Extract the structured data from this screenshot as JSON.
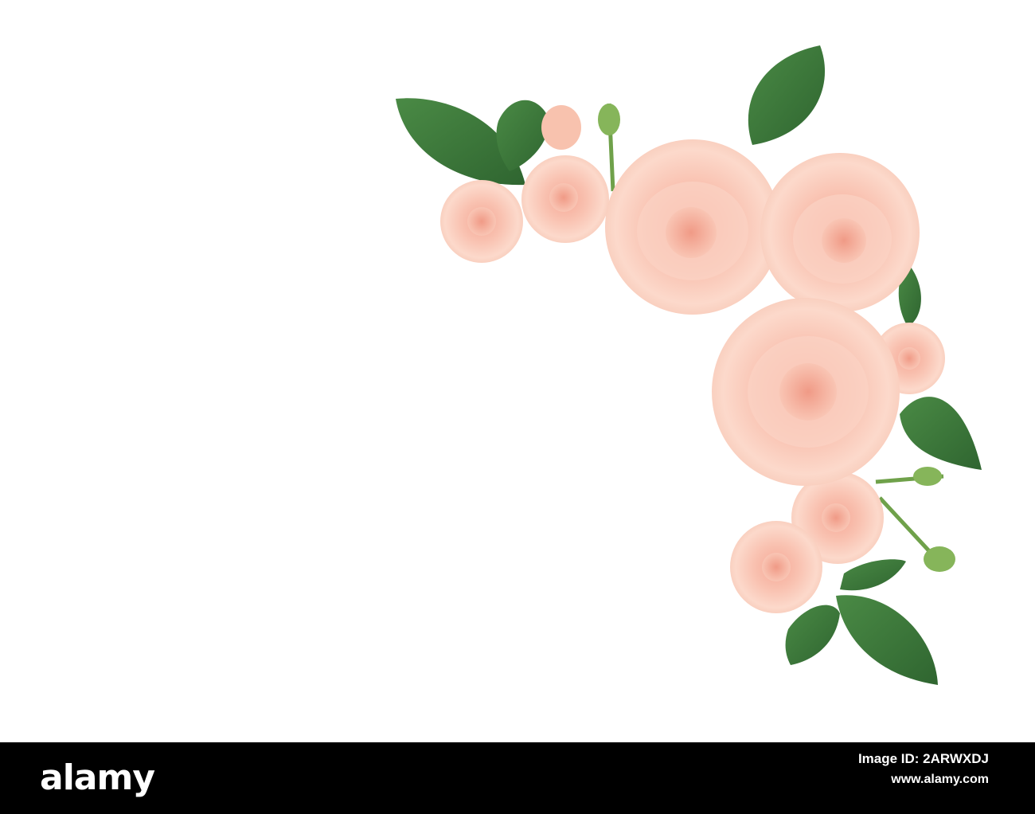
{
  "photo": {
    "subject": "flower-arrangement",
    "background_color": "#ffffff",
    "rose_color": "#f7b9a8",
    "rose_highlight": "#fde6d9",
    "leaf_color": "#3d7a3a",
    "leaf_dark": "#2a5d29"
  },
  "footer": {
    "background_color": "#000000",
    "logo_text": "alamy",
    "image_id_label": "Image ID: 2ARWXDJ",
    "site": "www.alamy.com"
  }
}
